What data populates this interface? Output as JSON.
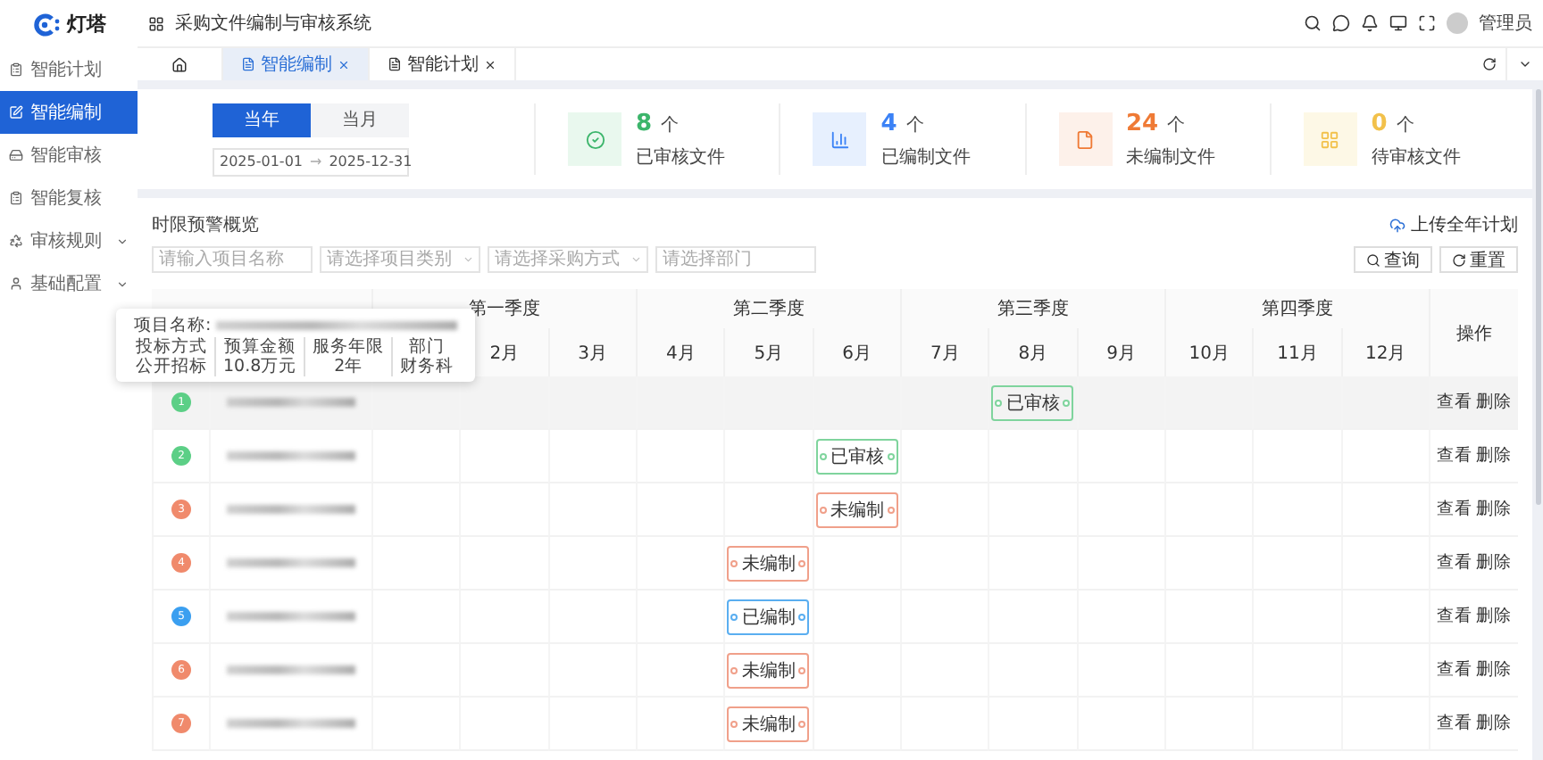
{
  "logo": {
    "text": "灯塔"
  },
  "header": {
    "title": "采购文件编制与审核系统",
    "user": "管理员"
  },
  "sidebar": {
    "items": [
      {
        "label": "智能计划",
        "selected": false
      },
      {
        "label": "智能编制",
        "selected": true
      },
      {
        "label": "智能审核",
        "selected": false
      },
      {
        "label": "智能复核",
        "selected": false
      },
      {
        "label": "审核规则",
        "selected": false,
        "expanded": false
      },
      {
        "label": "基础配置",
        "selected": false,
        "expanded": false
      }
    ]
  },
  "tabs": [
    {
      "kind": "home",
      "selected": false
    },
    {
      "kind": "page",
      "label": "智能编制",
      "selected": true
    },
    {
      "kind": "page",
      "label": "智能计划",
      "selected": false
    }
  ],
  "period": {
    "options": [
      {
        "label": "当年",
        "selected": true
      },
      {
        "label": "当月",
        "selected": false
      }
    ],
    "start": "2025-01-01",
    "separator": "→",
    "end": "2025-12-31"
  },
  "stats": [
    {
      "kind": "approved",
      "value": "8",
      "unit": "个",
      "label": "已审核文件"
    },
    {
      "kind": "drafted",
      "value": "4",
      "unit": "个",
      "label": "已编制文件"
    },
    {
      "kind": "undrafted",
      "value": "24",
      "unit": "个",
      "label": "未编制文件"
    },
    {
      "kind": "pending",
      "value": "0",
      "unit": "个",
      "label": "待审核文件"
    }
  ],
  "overview": {
    "title": "时限预警概览",
    "upload": "上传全年计划",
    "filters": [
      {
        "placeholder": "请输入项目名称",
        "dropdown": false
      },
      {
        "placeholder": "请选择项目类别",
        "dropdown": true
      },
      {
        "placeholder": "请选择采购方式",
        "dropdown": true
      },
      {
        "placeholder": "请选择部门",
        "dropdown": false
      }
    ],
    "buttons": [
      {
        "kind": "search",
        "label": "查询"
      },
      {
        "kind": "reset",
        "label": "重置"
      }
    ]
  },
  "table": {
    "quarters": [
      "第一季度",
      "第二季度",
      "第三季度",
      "第四季度"
    ],
    "months": [
      "2月",
      "3月",
      "4月",
      "5月",
      "6月",
      "7月",
      "8月",
      "9月",
      "10月",
      "11月",
      "12月"
    ],
    "action_header": "操作",
    "rows": [
      {
        "number": "1",
        "color": "#5ccf86",
        "hovered": true,
        "cells": [
          null,
          null,
          null,
          null,
          null,
          null,
          null,
          {
            "kind": "approved",
            "label": "已审核"
          },
          null,
          null,
          null,
          null
        ],
        "actions": [
          "查看",
          "删除"
        ]
      },
      {
        "number": "2",
        "color": "#5ccf86",
        "hovered": false,
        "cells": [
          null,
          null,
          null,
          null,
          null,
          {
            "kind": "approved",
            "label": "已审核"
          },
          null,
          null,
          null,
          null,
          null,
          null
        ],
        "actions": [
          "查看",
          "删除"
        ]
      },
      {
        "number": "3",
        "color": "#f08a6c",
        "hovered": false,
        "cells": [
          null,
          null,
          null,
          null,
          null,
          {
            "kind": "undrafted",
            "label": "未编制"
          },
          null,
          null,
          null,
          null,
          null,
          null
        ],
        "actions": [
          "查看",
          "删除"
        ]
      },
      {
        "number": "4",
        "color": "#f08a6c",
        "hovered": false,
        "cells": [
          null,
          null,
          null,
          null,
          {
            "kind": "undrafted",
            "label": "未编制"
          },
          null,
          null,
          null,
          null,
          null,
          null,
          null
        ],
        "actions": [
          "查看",
          "删除"
        ]
      },
      {
        "number": "5",
        "color": "#3b9ff0",
        "hovered": false,
        "cells": [
          null,
          null,
          null,
          null,
          {
            "kind": "drafted",
            "label": "已编制"
          },
          null,
          null,
          null,
          null,
          null,
          null,
          null
        ],
        "actions": [
          "查看",
          "删除"
        ]
      },
      {
        "number": "6",
        "color": "#f08a6c",
        "hovered": false,
        "cells": [
          null,
          null,
          null,
          null,
          {
            "kind": "undrafted",
            "label": "未编制"
          },
          null,
          null,
          null,
          null,
          null,
          null,
          null
        ],
        "actions": [
          "查看",
          "删除"
        ]
      },
      {
        "number": "7",
        "color": "#f08a6c",
        "hovered": false,
        "cells": [
          null,
          null,
          null,
          null,
          {
            "kind": "undrafted",
            "label": "未编制"
          },
          null,
          null,
          null,
          null,
          null,
          null,
          null
        ],
        "actions": [
          "查看",
          "删除"
        ]
      }
    ]
  },
  "tooltip": {
    "name_label": "项目名称:",
    "columns": [
      {
        "heading": "投标方式",
        "value": "公开招标"
      },
      {
        "heading": "预算金额",
        "value": "10.8万元"
      },
      {
        "heading": "服务年限",
        "value": "2年"
      },
      {
        "heading": "部门",
        "value": "财务科"
      }
    ]
  }
}
